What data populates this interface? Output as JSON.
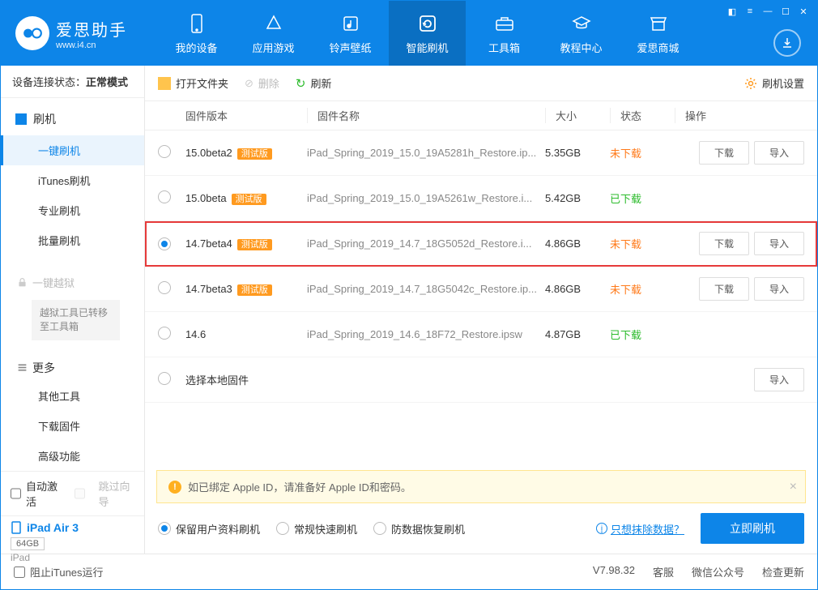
{
  "brand": {
    "title": "爱思助手",
    "subtitle": "www.i4.cn"
  },
  "nav": {
    "items": [
      {
        "label": "我的设备"
      },
      {
        "label": "应用游戏"
      },
      {
        "label": "铃声壁纸"
      },
      {
        "label": "智能刷机"
      },
      {
        "label": "工具箱"
      },
      {
        "label": "教程中心"
      },
      {
        "label": "爱思商城"
      }
    ]
  },
  "sidebar": {
    "status_label": "设备连接状态：",
    "status_value": "正常模式",
    "flash_head": "刷机",
    "items": {
      "oneclick": "一键刷机",
      "itunes": "iTunes刷机",
      "pro": "专业刷机",
      "batch": "批量刷机"
    },
    "jailbreak_head": "一键越狱",
    "jailbreak_note": "越狱工具已转移至工具箱",
    "more_head": "更多",
    "more": {
      "other": "其他工具",
      "download": "下载固件",
      "advanced": "高级功能"
    },
    "auto_activate": "自动激活",
    "skip_guide": "跳过向导",
    "device": {
      "name": "iPad Air 3",
      "storage": "64GB",
      "type": "iPad"
    }
  },
  "toolbar": {
    "open": "打开文件夹",
    "delete": "删除",
    "refresh": "刷新",
    "settings": "刷机设置"
  },
  "table": {
    "headers": {
      "version": "固件版本",
      "name": "固件名称",
      "size": "大小",
      "status": "状态",
      "ops": "操作"
    },
    "btn_download": "下载",
    "btn_import": "导入",
    "beta_tag": "测试版",
    "rows": [
      {
        "version": "15.0beta2",
        "beta": true,
        "name": "iPad_Spring_2019_15.0_19A5281h_Restore.ip...",
        "size": "5.35GB",
        "status": "未下载",
        "status_cls": "status-not",
        "selected": false,
        "show_ops": true
      },
      {
        "version": "15.0beta",
        "beta": true,
        "name": "iPad_Spring_2019_15.0_19A5261w_Restore.i...",
        "size": "5.42GB",
        "status": "已下载",
        "status_cls": "status-done",
        "selected": false,
        "show_ops": false
      },
      {
        "version": "14.7beta4",
        "beta": true,
        "name": "iPad_Spring_2019_14.7_18G5052d_Restore.i...",
        "size": "4.86GB",
        "status": "未下载",
        "status_cls": "status-not",
        "selected": true,
        "show_ops": true,
        "highlight": true
      },
      {
        "version": "14.7beta3",
        "beta": true,
        "name": "iPad_Spring_2019_14.7_18G5042c_Restore.ip...",
        "size": "4.86GB",
        "status": "未下载",
        "status_cls": "status-not",
        "selected": false,
        "show_ops": true
      },
      {
        "version": "14.6",
        "beta": false,
        "name": "iPad_Spring_2019_14.6_18F72_Restore.ipsw",
        "size": "4.87GB",
        "status": "已下载",
        "status_cls": "status-done",
        "selected": false,
        "show_ops": false
      }
    ],
    "local_row": "选择本地固件"
  },
  "notice": "如已绑定 Apple ID，请准备好 Apple ID和密码。",
  "actions": {
    "opt1": "保留用户资料刷机",
    "opt2": "常规快速刷机",
    "opt3": "防数据恢复刷机",
    "erase_link": "只想抹除数据？",
    "flash_btn": "立即刷机"
  },
  "footer": {
    "block_itunes": "阻止iTunes运行",
    "version": "V7.98.32",
    "service": "客服",
    "wechat": "微信公众号",
    "update": "检查更新"
  }
}
